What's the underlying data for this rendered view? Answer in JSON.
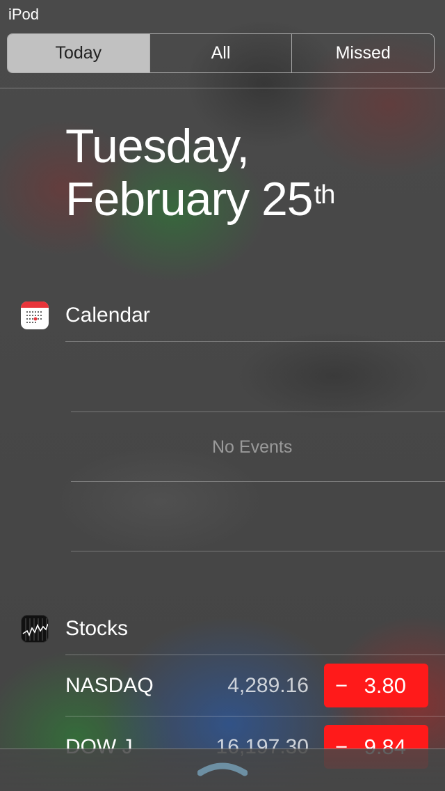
{
  "status_bar": {
    "carrier": "iPod"
  },
  "segments": {
    "today": "Today",
    "all": "All",
    "missed": "Missed"
  },
  "date": {
    "weekday": "Tuesday,",
    "month_day": "February 25",
    "suffix": "th"
  },
  "calendar": {
    "title": "Calendar",
    "empty_text": "No Events"
  },
  "stocks": {
    "title": "Stocks",
    "rows": [
      {
        "name": "NASDAQ",
        "price": "4,289.16",
        "change_sign": "−",
        "change": "3.80"
      },
      {
        "name": "DOW J",
        "price": "16,197.30",
        "change_sign": "−",
        "change": "9.84"
      }
    ]
  },
  "icons": {
    "calendar": "calendar-icon",
    "stocks": "stocks-icon",
    "grabber": "chevron-up-icon"
  },
  "colors": {
    "change_negative": "#ff1a1a",
    "segment_active": "#d2d2d2"
  }
}
